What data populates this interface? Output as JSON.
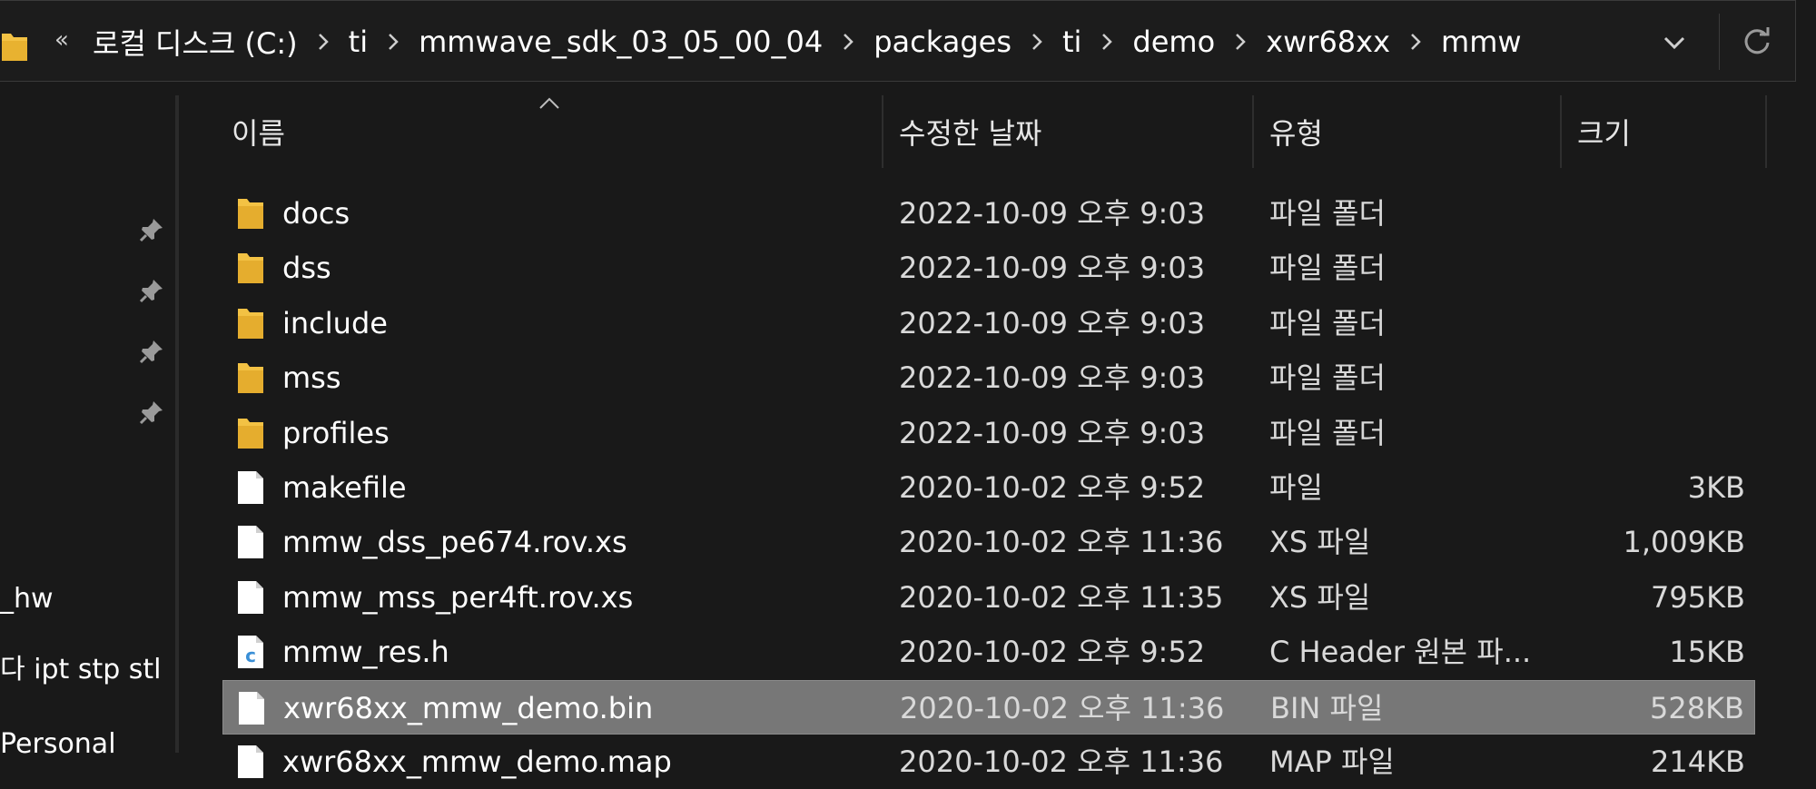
{
  "colors": {
    "background": "#191919",
    "text": "#ffffff",
    "folder": "#f3c244",
    "selected_row": "#777777",
    "c_header_icon": "#3a8fd6"
  },
  "address_bar": {
    "overflow_glyph": "«",
    "crumbs": [
      "로컬 디스크 (C:)",
      "ti",
      "mmwave_sdk_03_05_00_04",
      "packages",
      "ti",
      "demo",
      "xwr68xx",
      "mmw"
    ],
    "icons": {
      "folder": "folder-icon",
      "separator": "chevron-right-icon",
      "dropdown": "chevron-down-icon",
      "refresh": "refresh-icon"
    }
  },
  "nav_pane": {
    "pinned_icon": "pin-icon",
    "items": [
      "_hw",
      "다 ipt stp stl",
      "Personal"
    ]
  },
  "file_list": {
    "sort_icon": "sort-ascending-icon",
    "columns": {
      "name": "이름",
      "date": "수정한 날짜",
      "type": "유형",
      "size": "크기"
    },
    "rows": [
      {
        "icon": "folder-icon",
        "name": "docs",
        "date": "2022-10-09 오후 9:03",
        "type": "파일 폴더",
        "size": ""
      },
      {
        "icon": "folder-icon",
        "name": "dss",
        "date": "2022-10-09 오후 9:03",
        "type": "파일 폴더",
        "size": ""
      },
      {
        "icon": "folder-icon",
        "name": "include",
        "date": "2022-10-09 오후 9:03",
        "type": "파일 폴더",
        "size": ""
      },
      {
        "icon": "folder-icon",
        "name": "mss",
        "date": "2022-10-09 오후 9:03",
        "type": "파일 폴더",
        "size": ""
      },
      {
        "icon": "folder-icon",
        "name": "profiles",
        "date": "2022-10-09 오후 9:03",
        "type": "파일 폴더",
        "size": ""
      },
      {
        "icon": "file-icon",
        "name": "makefile",
        "date": "2020-10-02 오후 9:52",
        "type": "파일",
        "size": "3KB"
      },
      {
        "icon": "file-icon",
        "name": "mmw_dss_pe674.rov.xs",
        "date": "2020-10-02 오후 11:36",
        "type": "XS 파일",
        "size": "1,009KB"
      },
      {
        "icon": "file-icon",
        "name": "mmw_mss_per4ft.rov.xs",
        "date": "2020-10-02 오후 11:35",
        "type": "XS 파일",
        "size": "795KB"
      },
      {
        "icon": "c-header-icon",
        "name": "mmw_res.h",
        "date": "2020-10-02 오후 9:52",
        "type": "C Header 원본 파...",
        "size": "15KB"
      },
      {
        "icon": "file-icon",
        "name": "xwr68xx_mmw_demo.bin",
        "date": "2020-10-02 오후 11:36",
        "type": "BIN 파일",
        "size": "528KB",
        "selected": true
      },
      {
        "icon": "file-icon",
        "name": "xwr68xx_mmw_demo.map",
        "date": "2020-10-02 오후 11:36",
        "type": "MAP 파일",
        "size": "214KB"
      }
    ]
  }
}
